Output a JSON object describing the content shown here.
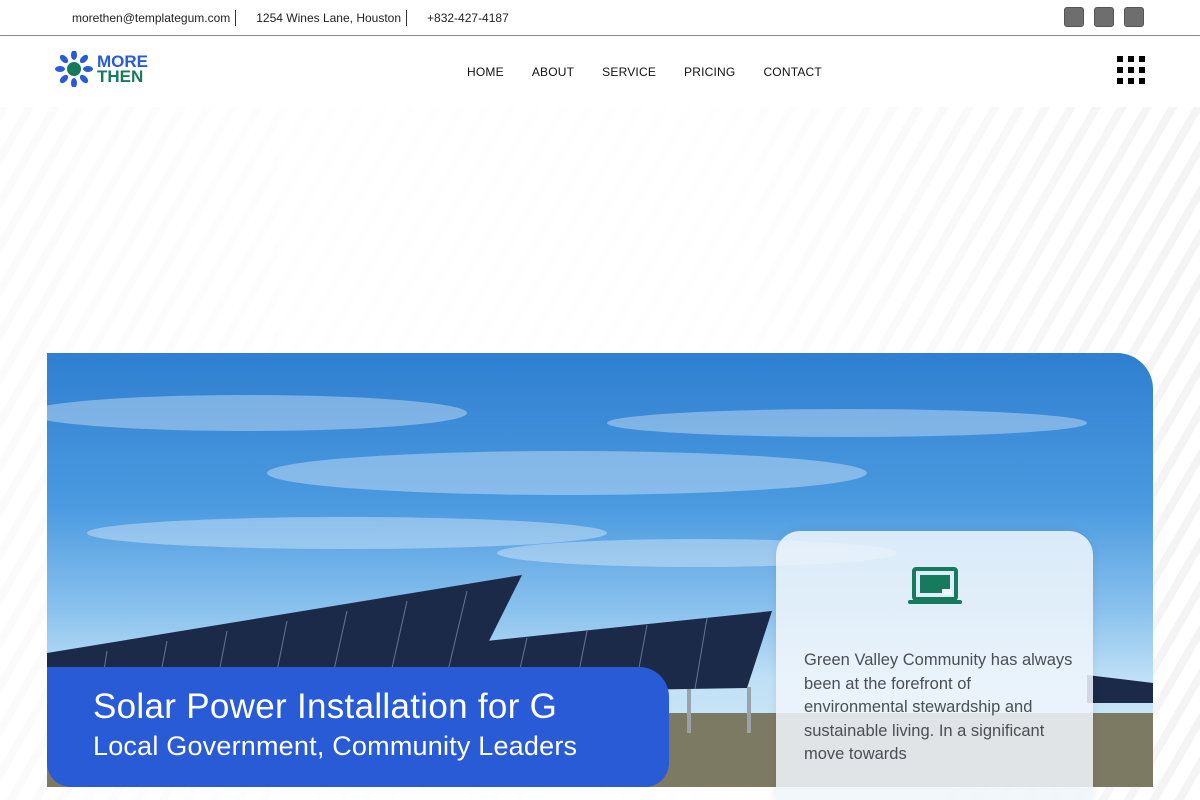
{
  "topbar": {
    "email": "morethen@templategum.com",
    "address": "1254 Wines Lane, Houston",
    "phone": "+832-427-4187"
  },
  "logo": {
    "line1": "MORE",
    "line2": "THEN"
  },
  "nav": [
    {
      "label": "HOME"
    },
    {
      "label": "ABOUT"
    },
    {
      "label": "SERVICE"
    },
    {
      "label": "PRICING"
    },
    {
      "label": "CONTACT"
    }
  ],
  "hero": {
    "title": "Solar Power Installation for G",
    "subtitle": "Local Government, Community Leaders"
  },
  "card": {
    "icon": "laptop-icon",
    "text": "Green Valley Community has always been at the forefront of environmental stewardship and sustainable living. In a significant move towards"
  },
  "colors": {
    "brand_blue": "#2a5bd7",
    "brand_green": "#167a5c"
  }
}
